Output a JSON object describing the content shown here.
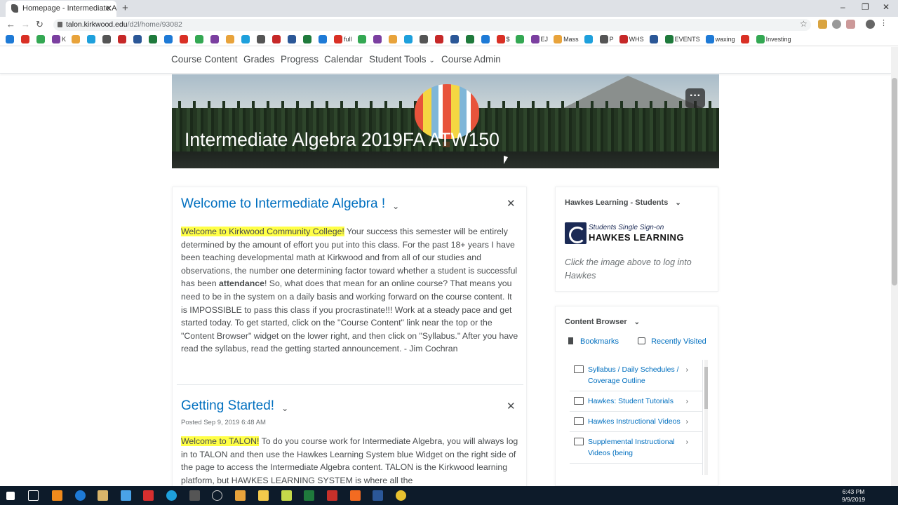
{
  "browser": {
    "tab_title": "Homepage - Intermediate Algebra",
    "new_tab": "+",
    "url_domain": "talon.kirkwood.edu",
    "url_path": "/d2l/home/93082"
  },
  "bookmarks": [
    "",
    "",
    "",
    "K",
    "",
    "",
    "",
    "",
    "",
    "",
    "",
    "",
    "",
    "",
    "",
    "",
    "",
    "",
    "",
    "",
    "",
    "full",
    "",
    "",
    "",
    "",
    "",
    "",
    "",
    "",
    "",
    "$",
    "",
    "EJ",
    "Mass",
    "",
    "P",
    "WHS",
    "",
    "EVENTS",
    "waxing",
    "",
    "Investing"
  ],
  "nav": {
    "items": [
      "Course Content",
      "Grades",
      "Progress",
      "Calendar",
      "Student Tools",
      "Course Admin"
    ]
  },
  "banner": {
    "title": "Intermediate Algebra 2019FA ATW150",
    "menu": "···"
  },
  "announcements": [
    {
      "title": "Welcome to Intermediate Algebra !",
      "highlight": "Welcome to Kirkwood Community College!",
      "body_a": " Your success this semester will be entirely determined by the amount of effort you put into this class. For the past 18+ years I have been teaching developmental math at Kirkwood and from all of our studies and observations, the number one determining factor toward whether a student is successful has been ",
      "bold": "attendance",
      "body_b": "! So, what does that mean for an online course?  That means you need to be in the system on a daily basis and working forward on the course content.  It is IMPOSSIBLE to pass this class if you procrastinate!!! Work at a steady pace and get started today.  To get started, click on the \"Course Content\" link near the top or the \"Content Browser\" widget on the lower right, and then click on \"Syllabus.\"  After you have read the syllabus, read the getting started announcement.  - Jim Cochran"
    },
    {
      "title": "Getting Started!",
      "posted": "Posted Sep 9, 2019 6:48 AM",
      "highlight": "Welcome to TALON!",
      "body_a": " To do you course work for Intermediate Algebra, you will always log in to TALON and then use the Hawkes Learning System blue Widget on the right side of the page to access the Intermediate Algebra content.  TALON is the Kirkwood learning platform, but HAWKES LEARNING SYSTEM is where all the"
    }
  ],
  "hawkes_widget": {
    "title": "Hawkes Learning - Students",
    "logo_top": "Students Single Sign-on",
    "logo_bottom": "HAWKES LEARNING",
    "hint": "Click the image above to log into Hawkes"
  },
  "content_browser": {
    "title": "Content Browser",
    "bookmarks": "Bookmarks",
    "recent": "Recently Visited",
    "items": [
      "Syllabus / Daily Schedules / Coverage Outline",
      "Hawkes: Student Tutorials",
      "Hawkes Instructional Videos",
      "Supplemental Instructional Videos (being"
    ]
  },
  "taskbar": {
    "time": "6:43 PM",
    "date": "9/9/2019"
  },
  "colors": {
    "link": "#006fbf",
    "highlight": "#ffff46",
    "text": "#494c4e"
  }
}
